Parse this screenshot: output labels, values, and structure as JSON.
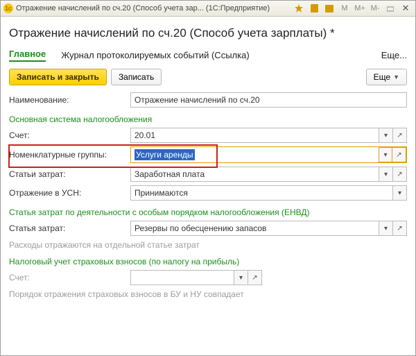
{
  "titlebar": {
    "title": "Отражение начислений по сч.20 (Способ учета зар... (1С:Предприятие)"
  },
  "page": {
    "title": "Отражение начислений по сч.20 (Способ учета зарплаты) *"
  },
  "tabs": {
    "main": "Главное",
    "log": "Журнал протоколируемых событий (Ссылка)",
    "more": "Еще..."
  },
  "toolbar": {
    "save_close": "Записать и закрыть",
    "save": "Записать",
    "more": "Еще"
  },
  "labels": {
    "name": "Наименование:",
    "main_tax": "Основная система налогообложения",
    "account": "Счет:",
    "nomen_groups": "Номенклатурные группы:",
    "cost_items": "Статьи затрат:",
    "usn": "Отражение в УСН:",
    "envd_title": "Статья затрат по деятельности с особым порядком налогообложения (ЕНВД)",
    "cost_item": "Статья затрат:",
    "envd_hint": "Расходы отражаются на отдельной статье затрат",
    "tax_ins_title": "Налоговый учет страховых взносов (по налогу на прибыль)",
    "account2": "Счет:",
    "tax_ins_hint": "Порядок отражения страховых взносов в БУ и НУ совпадает"
  },
  "values": {
    "name": "Отражение начислений по сч.20",
    "account": "20.01",
    "nomen_groups": "Услуги аренды",
    "cost_items": "Заработная плата",
    "usn": "Принимаются",
    "cost_item_envd": "Резервы по обесценению запасов",
    "account2": ""
  }
}
